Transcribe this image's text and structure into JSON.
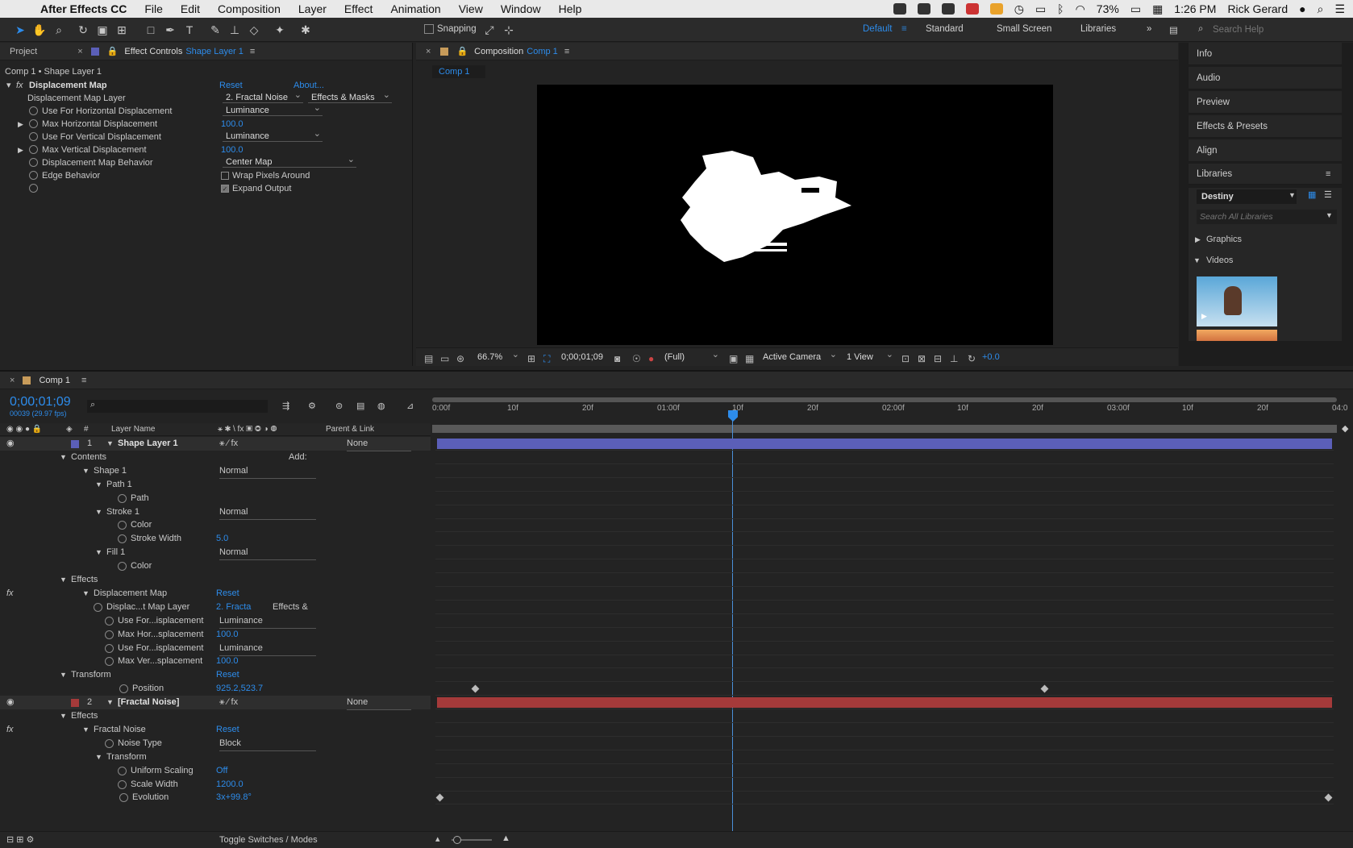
{
  "menubar": {
    "app": "After Effects CC",
    "items": [
      "File",
      "Edit",
      "Composition",
      "Layer",
      "Effect",
      "Animation",
      "View",
      "Window",
      "Help"
    ],
    "battery": "73%",
    "time": "1:26 PM",
    "user": "Rick Gerard"
  },
  "toolbar": {
    "snapping": "Snapping",
    "workspaces": [
      "Default",
      "Standard",
      "Small Screen",
      "Libraries"
    ],
    "search_placeholder": "Search Help"
  },
  "effect_controls": {
    "tab_project": "Project",
    "tab_label": "Effect Controls",
    "tab_layer": "Shape Layer 1",
    "breadcrumb": "Comp 1 • Shape Layer 1",
    "effect_name": "Displacement Map",
    "reset": "Reset",
    "about": "About...",
    "rows": [
      {
        "label": "Displacement Map Layer",
        "value": "2. Fractal Noise",
        "value2": "Effects & Masks"
      },
      {
        "label": "Use For Horizontal Displacement",
        "value": "Luminance"
      },
      {
        "label": "Max Horizontal Displacement",
        "value": "100.0"
      },
      {
        "label": "Use For Vertical Displacement",
        "value": "Luminance"
      },
      {
        "label": "Max Vertical Displacement",
        "value": "100.0"
      },
      {
        "label": "Displacement Map Behavior",
        "value": "Center Map"
      },
      {
        "label": "Edge Behavior",
        "value": "Wrap Pixels Around"
      },
      {
        "label": "",
        "value": "Expand Output"
      }
    ]
  },
  "composition": {
    "tab_label": "Composition",
    "tab_comp": "Comp 1",
    "subtab": "Comp 1",
    "zoom": "66.7%",
    "timecode": "0;00;01;09",
    "resolution": "(Full)",
    "camera": "Active Camera",
    "views": "1 View",
    "exposure": "+0.0"
  },
  "right_panel": {
    "items": [
      "Info",
      "Audio",
      "Preview",
      "Effects & Presets",
      "Align",
      "Libraries"
    ],
    "library": "Destiny",
    "search_placeholder": "Search All Libraries",
    "graphics": "Graphics",
    "videos": "Videos"
  },
  "timeline": {
    "tab": "Comp 1",
    "timecode": "0;00;01;09",
    "frames": "00039 (29.97 fps)",
    "col_layer": "Layer Name",
    "col_parent": "Parent & Link",
    "ruler": [
      "0:00f",
      "10f",
      "20f",
      "01:00f",
      "10f",
      "20f",
      "02:00f",
      "10f",
      "20f",
      "03:00f",
      "10f",
      "20f",
      "04:0"
    ],
    "toggle": "Toggle Switches / Modes",
    "add": "Add:",
    "rows": [
      {
        "num": "1",
        "name": "Shape Layer 1",
        "parent": "None"
      },
      {
        "name": "Contents"
      },
      {
        "name": "Shape 1",
        "mode": "Normal"
      },
      {
        "name": "Path 1"
      },
      {
        "name": "Path"
      },
      {
        "name": "Stroke 1",
        "mode": "Normal"
      },
      {
        "name": "Color"
      },
      {
        "name": "Stroke Width",
        "value": "5.0"
      },
      {
        "name": "Fill 1",
        "mode": "Normal"
      },
      {
        "name": "Color"
      },
      {
        "name": "Effects"
      },
      {
        "name": "Displacement Map",
        "value": "Reset"
      },
      {
        "name": "Displac...t Map Layer",
        "value": "2. Fracta",
        "value2": "Effects &"
      },
      {
        "name": "Use For...isplacement",
        "mode": "Luminance"
      },
      {
        "name": "Max Hor...splacement",
        "value": "100.0"
      },
      {
        "name": "Use For...isplacement",
        "mode": "Luminance"
      },
      {
        "name": "Max Ver...splacement",
        "value": "100.0"
      },
      {
        "name": "Transform",
        "value": "Reset"
      },
      {
        "name": "Position",
        "value": "925.2,523.7"
      },
      {
        "num": "2",
        "name": "[Fractal Noise]",
        "parent": "None"
      },
      {
        "name": "Effects"
      },
      {
        "name": "Fractal Noise",
        "value": "Reset"
      },
      {
        "name": "Noise Type",
        "mode": "Block"
      },
      {
        "name": "Transform"
      },
      {
        "name": "Uniform Scaling",
        "value": "Off"
      },
      {
        "name": "Scale Width",
        "value": "1200.0"
      },
      {
        "name": "Evolution",
        "value": "3x+99.8°"
      }
    ]
  },
  "colors": {
    "accent": "#2d8ceb",
    "layer1": "#5b5fb8",
    "layer2": "#a53a3a",
    "playhead": "#4a90d9"
  }
}
